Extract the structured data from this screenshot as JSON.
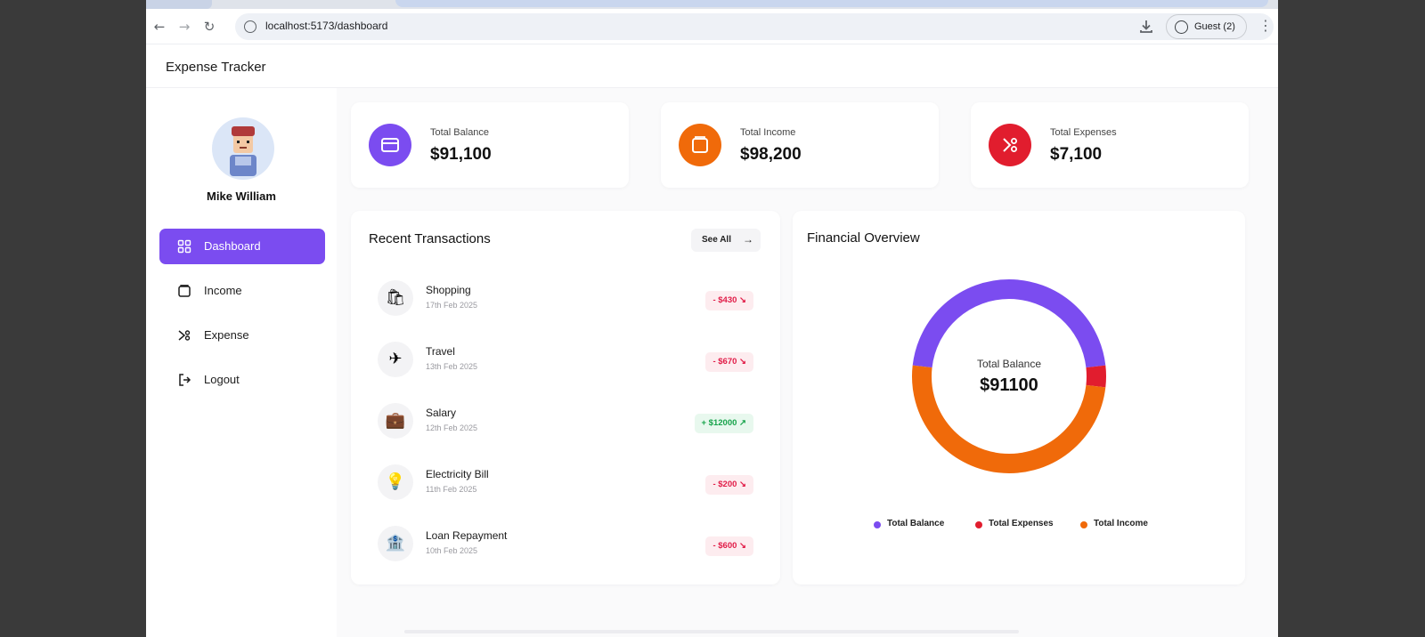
{
  "browser": {
    "url": "localhost:5173/dashboard",
    "profile_label": "Guest",
    "profile_count": "(2)",
    "back_icon": "←",
    "forward_icon": "→",
    "reload_icon": "↻",
    "menu_icon": "⋮"
  },
  "app": {
    "title": "Expense Tracker"
  },
  "user": {
    "name": "Mike William"
  },
  "sidebar": {
    "items": [
      {
        "label": "Dashboard",
        "icon": "dashboard-grid-icon",
        "active": true
      },
      {
        "label": "Income",
        "icon": "wallet-icon",
        "active": false
      },
      {
        "label": "Expense",
        "icon": "expense-icon",
        "active": false
      },
      {
        "label": "Logout",
        "icon": "logout-icon",
        "active": false
      }
    ]
  },
  "stats": [
    {
      "label": "Total Balance",
      "value": "$91,100",
      "color": "#7b4cf0",
      "icon": "card-icon"
    },
    {
      "label": "Total Income",
      "value": "$98,200",
      "color": "#f06a0a",
      "icon": "wallet-icon"
    },
    {
      "label": "Total Expenses",
      "value": "$7,100",
      "color": "#e11d2e",
      "icon": "expense-icon"
    }
  ],
  "recent": {
    "title": "Recent Transactions",
    "see_all": "See All",
    "items": [
      {
        "name": "Shopping",
        "date": "17th Feb 2025",
        "amount": "- $430",
        "type": "expense",
        "icon": "🛍"
      },
      {
        "name": "Travel",
        "date": "13th Feb 2025",
        "amount": "- $670",
        "type": "expense",
        "icon": "✈"
      },
      {
        "name": "Salary",
        "date": "12th Feb 2025",
        "amount": "+ $12000",
        "type": "income",
        "icon": "💼"
      },
      {
        "name": "Electricity Bill",
        "date": "11th Feb 2025",
        "amount": "- $200",
        "type": "expense",
        "icon": "💡"
      },
      {
        "name": "Loan Repayment",
        "date": "10th Feb 2025",
        "amount": "- $600",
        "type": "expense",
        "icon": "🏦"
      }
    ]
  },
  "overview": {
    "title": "Financial Overview",
    "center_label": "Total Balance",
    "center_value": "$91100",
    "legend": [
      {
        "label": "Total Balance",
        "color": "#7b4cf0"
      },
      {
        "label": "Total Expenses",
        "color": "#e11d2e"
      },
      {
        "label": "Total Income",
        "color": "#f06a0a"
      }
    ]
  },
  "chart_data": {
    "type": "pie",
    "title": "Financial Overview",
    "categories": [
      "Total Balance",
      "Total Expenses",
      "Total Income"
    ],
    "values": [
      91100,
      7100,
      98200
    ],
    "colors": [
      "#7b4cf0",
      "#e11d2e",
      "#f06a0a"
    ],
    "legend": "bottom"
  }
}
